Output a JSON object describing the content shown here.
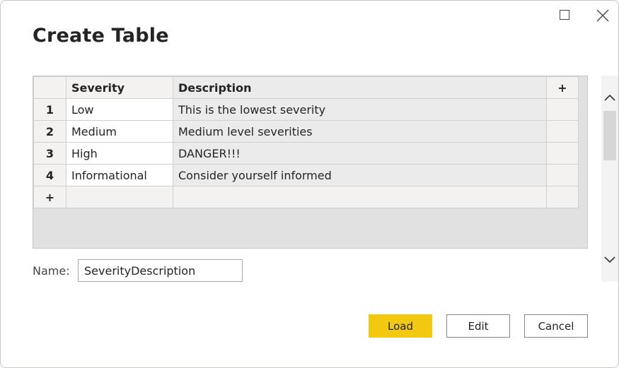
{
  "dialog": {
    "title": "Create Table",
    "window_controls": {
      "maximize_icon": "maximize-icon",
      "close_icon": "close-icon"
    }
  },
  "grid": {
    "columns": [
      "Severity",
      "Description"
    ],
    "add_column_label": "+",
    "rows": [
      {
        "num": "1",
        "severity": "Low",
        "description": "This is the lowest severity"
      },
      {
        "num": "2",
        "severity": "Medium",
        "description": "Medium level severities"
      },
      {
        "num": "3",
        "severity": "High",
        "description": "DANGER!!!"
      },
      {
        "num": "4",
        "severity": "Informational",
        "description": "Consider yourself informed"
      }
    ],
    "add_row_label": "+"
  },
  "name_field": {
    "label": "Name:",
    "value": "SeverityDescription"
  },
  "buttons": {
    "load": "Load",
    "edit": "Edit",
    "cancel": "Cancel"
  },
  "colors": {
    "load_button": "#f2c811",
    "grid_background": "#e1e1e1"
  }
}
